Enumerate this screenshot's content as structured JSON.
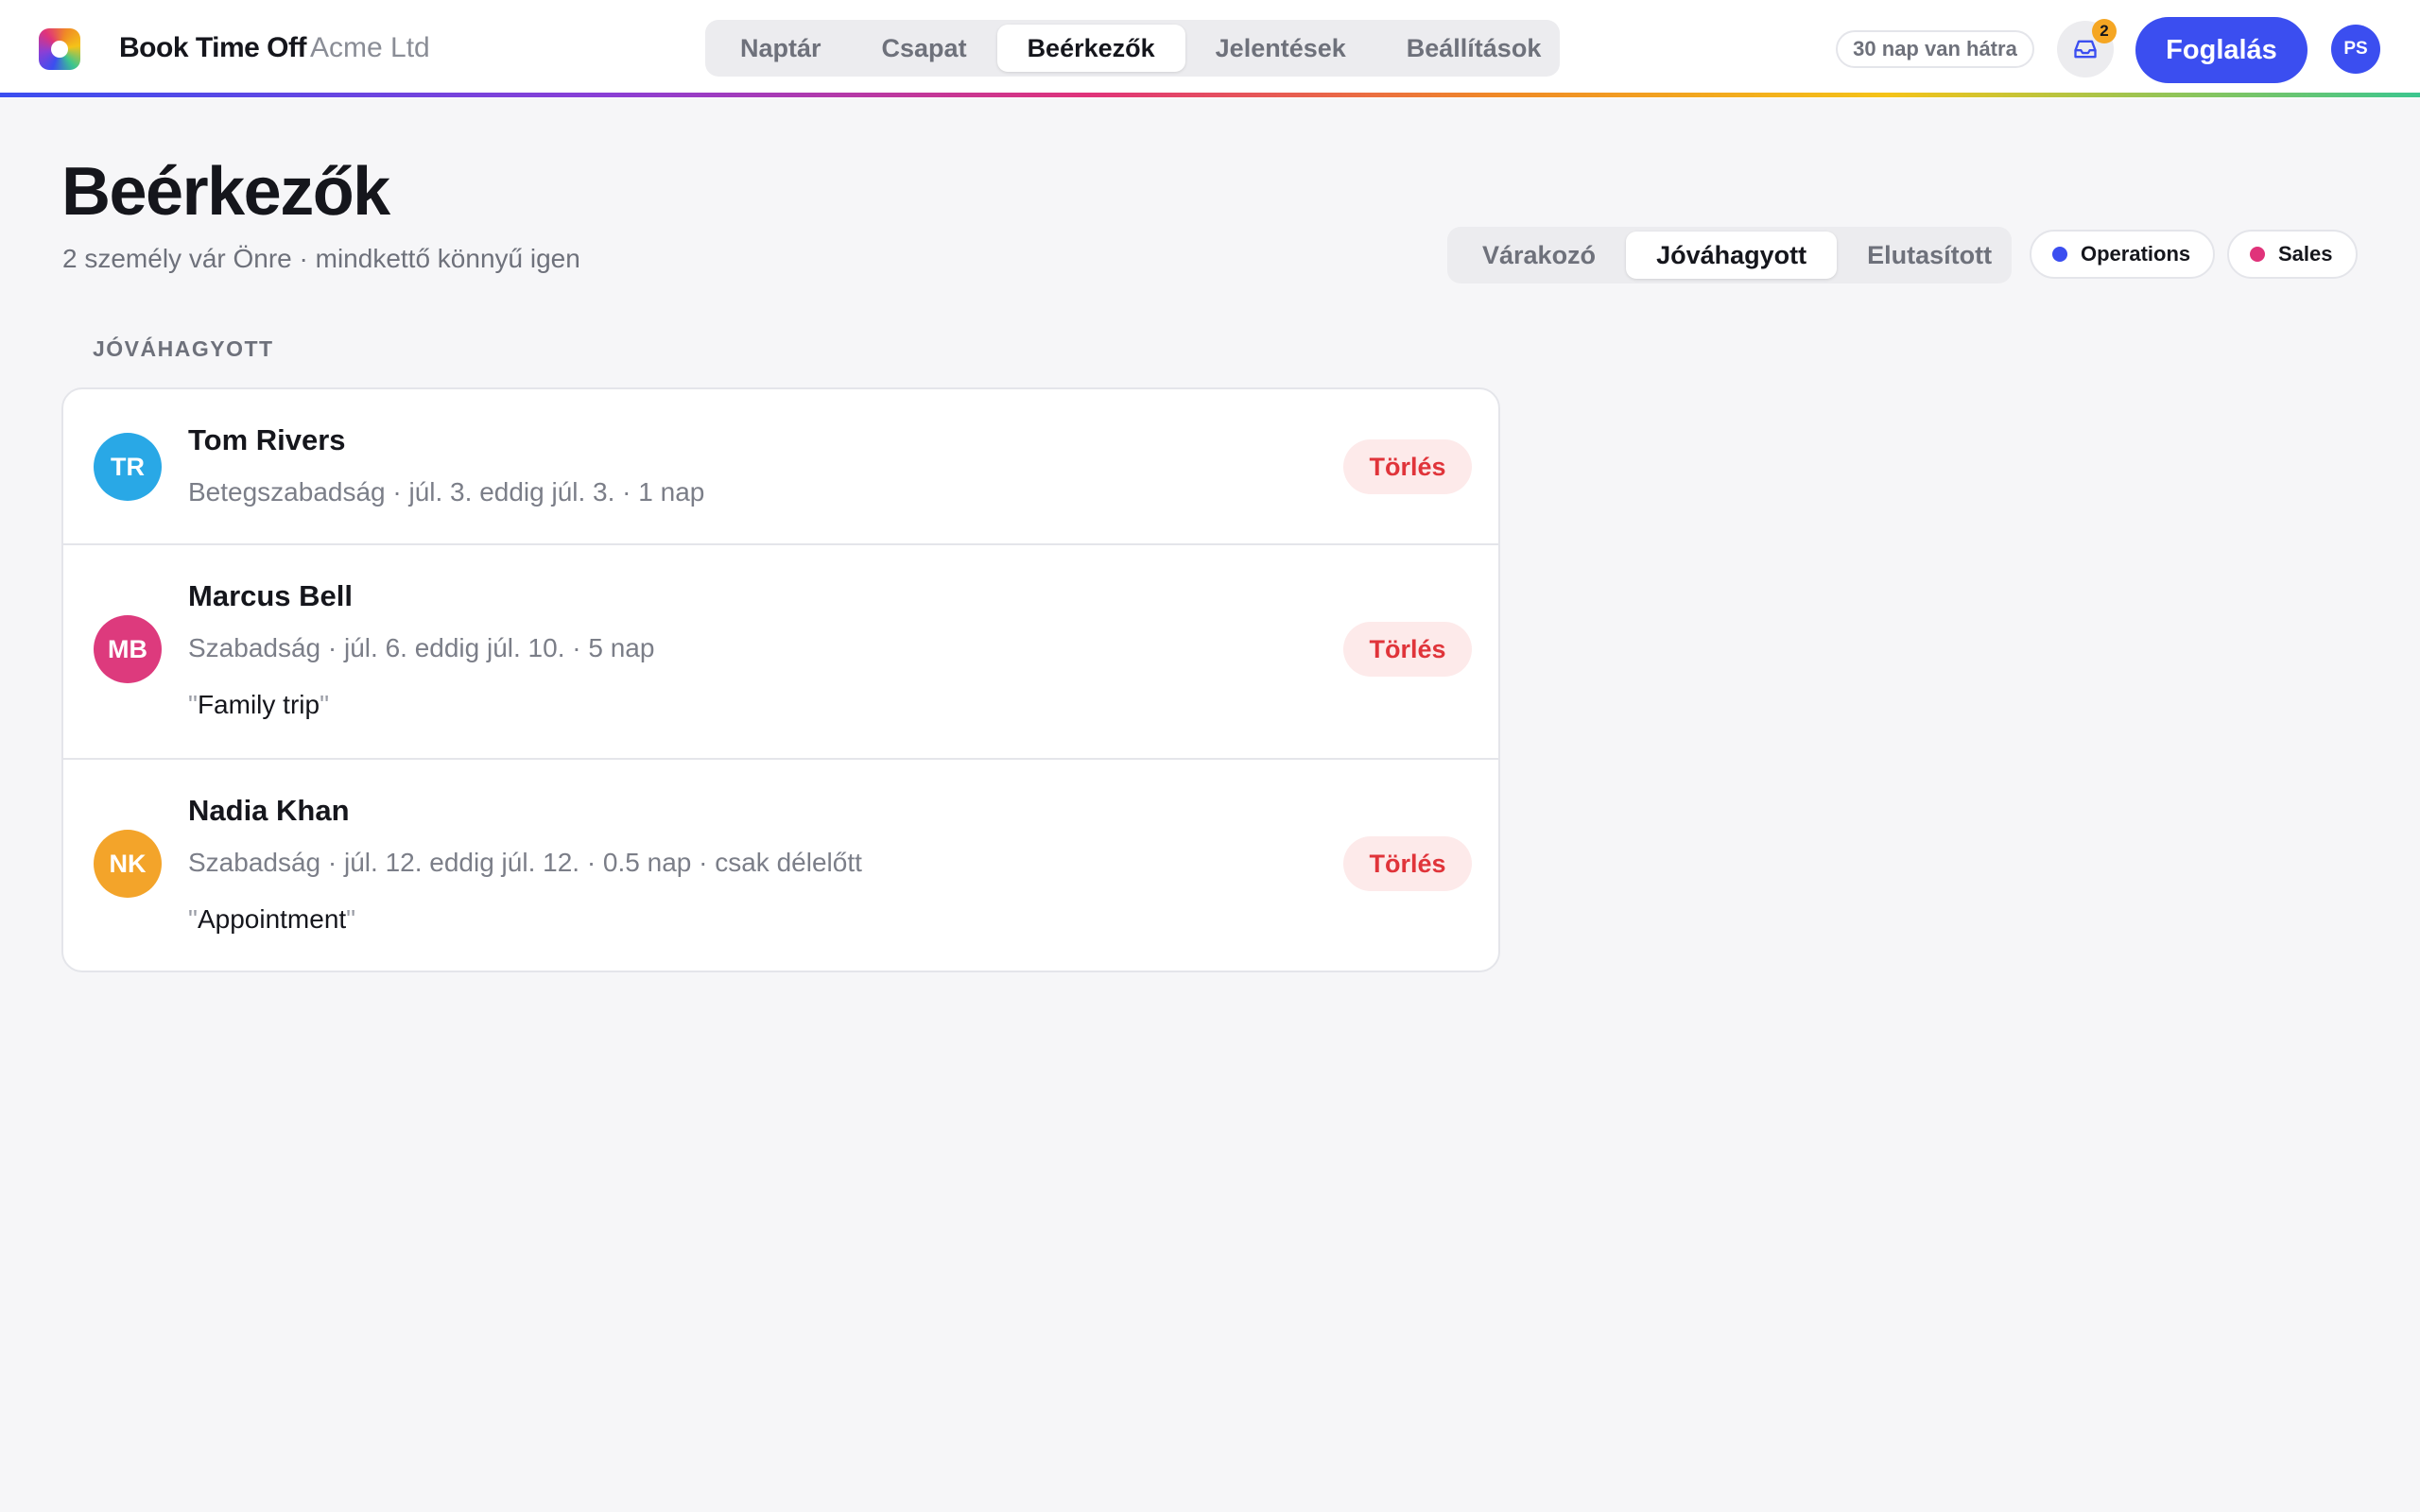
{
  "app": {
    "brand": "Book Time Off",
    "org": "Acme Ltd"
  },
  "nav": {
    "tabs": [
      {
        "label": "Naptár"
      },
      {
        "label": "Csapat"
      },
      {
        "label": "Beérkezők",
        "active": true
      },
      {
        "label": "Jelentések"
      },
      {
        "label": "Beállítások"
      }
    ]
  },
  "header": {
    "days_left": "30 nap van hátra",
    "inbox_count": "2",
    "book_label": "Foglalás",
    "user_initials": "PS"
  },
  "page": {
    "title": "Beérkezők",
    "subtitle": "2 személy vár Önre · mindkettő könnyű igen"
  },
  "status_tabs": [
    {
      "label": "Várakozó"
    },
    {
      "label": "Jóváhagyott",
      "active": true
    },
    {
      "label": "Elutasított"
    }
  ],
  "team_chips": [
    {
      "label": "Operations",
      "color": "#3b4ef0"
    },
    {
      "label": "Sales",
      "color": "#e0337a"
    }
  ],
  "section_label": "JÓVÁHAGYOTT",
  "requests": [
    {
      "initials": "TR",
      "avatar_color": "#29a8e6",
      "name": "Tom Rivers",
      "meta": "Betegszabadság · júl. 3. eddig júl. 3. · 1 nap",
      "note": "",
      "action": "Törlés"
    },
    {
      "initials": "MB",
      "avatar_color": "#dd3a7d",
      "name": "Marcus Bell",
      "meta": "Szabadság · júl. 6. eddig júl. 10. · 5 nap",
      "note": "Family trip",
      "action": "Törlés"
    },
    {
      "initials": "NK",
      "avatar_color": "#f3a42a",
      "name": "Nadia Khan",
      "meta": "Szabadság · júl. 12. eddig júl. 12. · 0.5 nap · csak délelőtt",
      "note": "Appointment",
      "action": "Törlés"
    }
  ],
  "icons": {
    "logo": "rainbow-ring-logo",
    "inbox": "inbox-tray-icon"
  }
}
